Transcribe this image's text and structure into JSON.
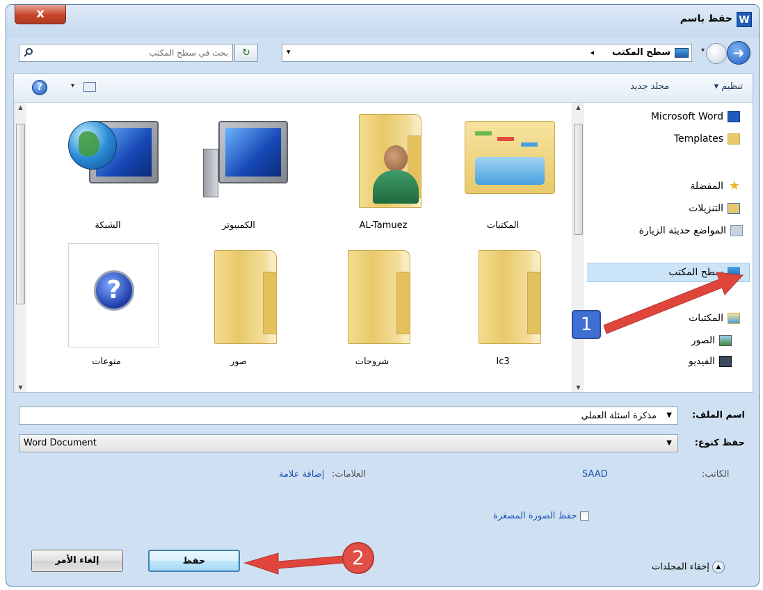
{
  "window": {
    "title": "حفظ باسم",
    "app_icon_letter": "W",
    "close_symbol": "x"
  },
  "address": {
    "location": "سطح المكتب",
    "breadcrumb_arrow": "◂",
    "search_placeholder": "بحث في سطح المكتب"
  },
  "toolbar": {
    "organize": "تنظيم ▾",
    "new_folder": "مجلد جديد",
    "help_symbol": "?"
  },
  "files": [
    {
      "label": "المكتبات",
      "icon": "libraries-icon"
    },
    {
      "label": "AL-Tamuez",
      "icon": "user-folder-icon"
    },
    {
      "label": "الكمبيوتر",
      "icon": "computer-icon"
    },
    {
      "label": "الشبكة",
      "icon": "network-icon"
    },
    {
      "label": "Ic3",
      "icon": "folder-icon"
    },
    {
      "label": "شروحات",
      "icon": "folder-icon"
    },
    {
      "label": "صور",
      "icon": "folder-icon"
    },
    {
      "label": "منوعات",
      "icon": "help-file-icon",
      "symbol": "?"
    }
  ],
  "nav": {
    "items": [
      {
        "label": "Microsoft Word",
        "icon": "word-icon"
      },
      {
        "label": "Templates",
        "icon": "folder-icon"
      },
      {
        "label": "المفضلة",
        "icon": "star-icon"
      },
      {
        "label": "التنزيلات",
        "icon": "downloads-icon"
      },
      {
        "label": "المواضع حديثة الزيارة",
        "icon": "recent-places-icon"
      },
      {
        "label": "سطح المكتب",
        "icon": "desktop-icon",
        "selected": true
      },
      {
        "label": "المكتبات",
        "icon": "libraries-icon"
      },
      {
        "label": "الصور",
        "icon": "pictures-icon"
      },
      {
        "label": "الفيديو",
        "icon": "video-icon"
      }
    ]
  },
  "form": {
    "filename_label": "اسم الملف:",
    "filename_value": "مذكرة اسئلة العملي",
    "type_label": "حفظ كنوع:",
    "type_value": "Word Document",
    "author_label": "الكاتب:",
    "author_value": "SAAD",
    "tags_label": "العلامات:",
    "tags_value": "إضافة علامة",
    "thumbnail_label": "حفظ الصورة المصغرة",
    "thumbnail_checked": false,
    "hide_folders": "إخفاء المجلدات"
  },
  "buttons": {
    "save": "حفظ",
    "cancel": "إلغاء الأمر"
  },
  "annotations": {
    "step1": "1",
    "step2": "2",
    "arrow_color": "#e0453c"
  }
}
